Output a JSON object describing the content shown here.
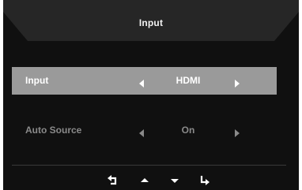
{
  "osd": {
    "title": "Input",
    "rows": [
      {
        "label": "Input",
        "value": "HDMI",
        "selected": true
      },
      {
        "label": "Auto Source",
        "value": "On",
        "selected": false
      }
    ],
    "nav_icons": [
      "return-icon",
      "up-arrow-icon",
      "down-arrow-icon",
      "enter-icon"
    ]
  },
  "colors": {
    "background": "#101010",
    "header": "#262626",
    "selected_row": "#9a9a9a",
    "dim_text": "#8a8a8a",
    "text": "#ffffff"
  }
}
